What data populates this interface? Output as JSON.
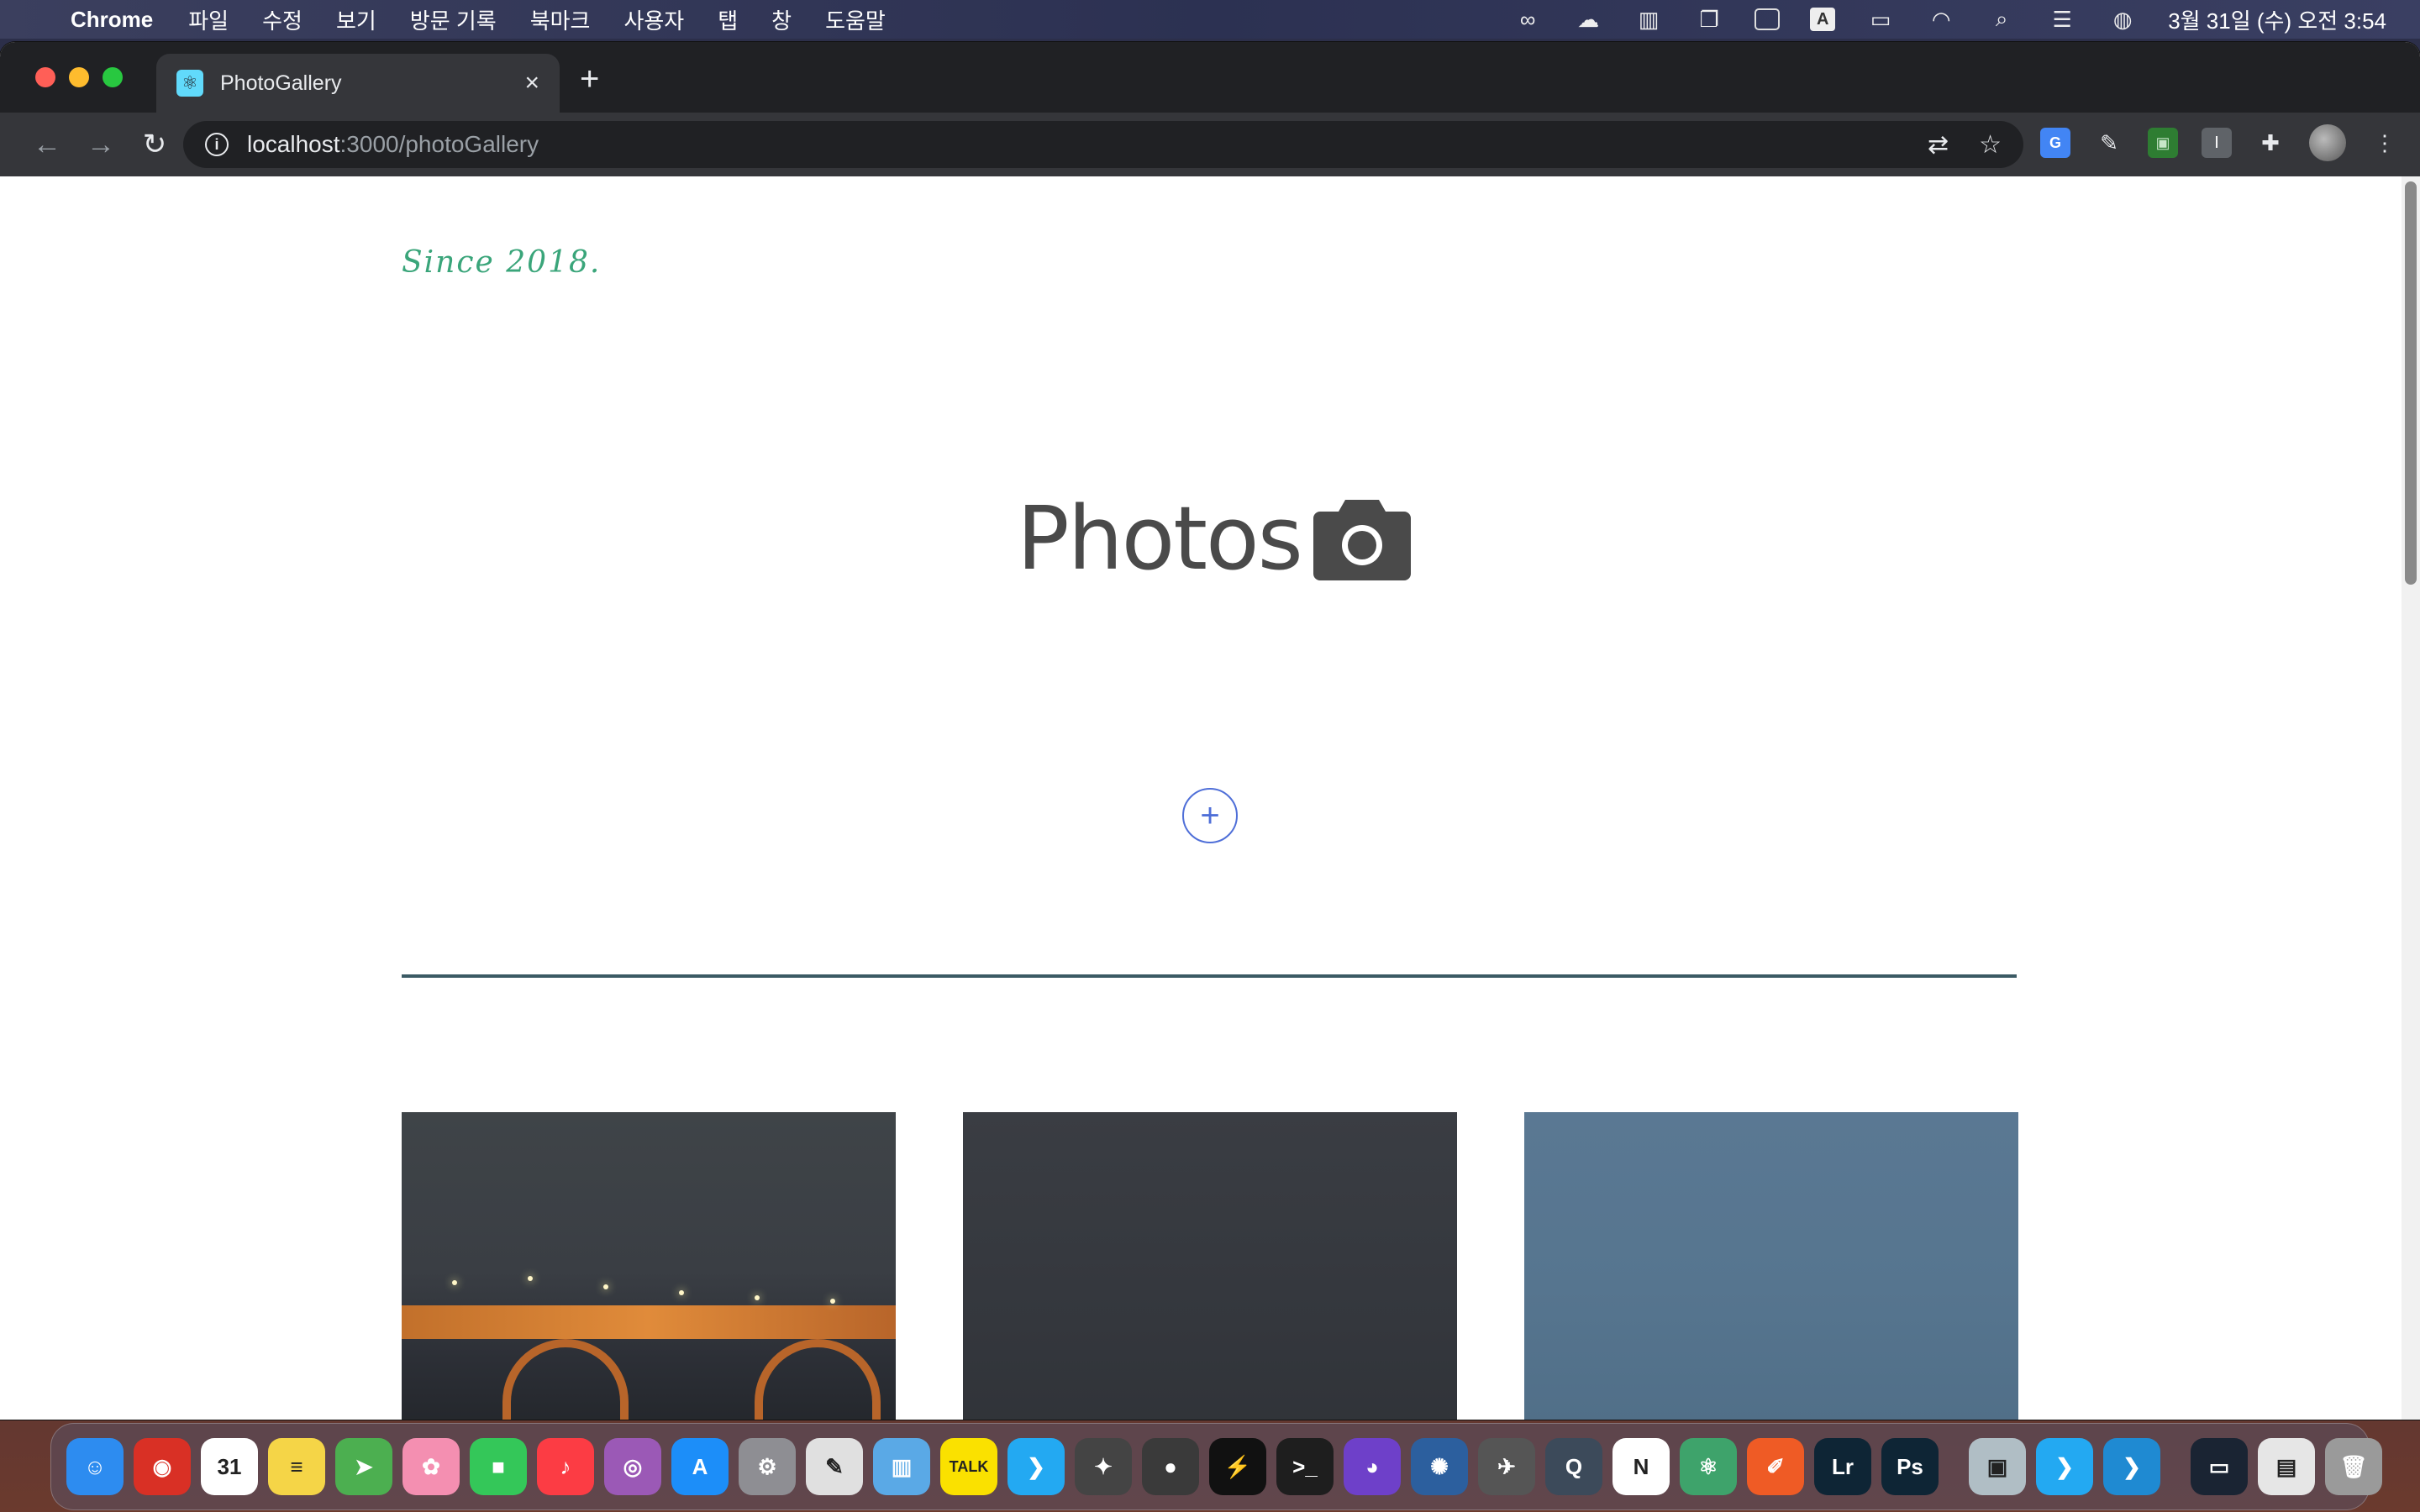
{
  "menubar": {
    "app_name": "Chrome",
    "menus": [
      "파일",
      "수정",
      "보기",
      "방문 기록",
      "북마크",
      "사용자",
      "탭",
      "창",
      "도움말"
    ],
    "status_icons": {
      "input_source": "A"
    },
    "clock": "3월 31일 (수) 오전 3:54"
  },
  "browser": {
    "tab_title": "PhotoGallery",
    "url_host": "localhost",
    "url_path": ":3000/photoGallery"
  },
  "page": {
    "since": "Since 2018.",
    "title": "Photos",
    "add_label": "+"
  },
  "dock": {
    "apps": [
      {
        "name": "finder-app-icon",
        "glyph": "☺",
        "color": "#2d8cf0"
      },
      {
        "name": "chrome-app-icon",
        "glyph": "◉",
        "color": "#d93025"
      },
      {
        "name": "calendar-app-icon",
        "glyph": "31",
        "color": "#ffffff"
      },
      {
        "name": "notes-app-icon",
        "glyph": "≡",
        "color": "#f5d547"
      },
      {
        "name": "maps-app-icon",
        "glyph": "➤",
        "color": "#4caf50"
      },
      {
        "name": "photos-app-icon",
        "glyph": "✿",
        "color": "#f48fb1"
      },
      {
        "name": "facetime-app-icon",
        "glyph": "■",
        "color": "#34c759"
      },
      {
        "name": "music-app-icon",
        "glyph": "♪",
        "color": "#fc3c44"
      },
      {
        "name": "podcast-app-icon",
        "glyph": "◎",
        "color": "#9b59b6"
      },
      {
        "name": "appstore-app-icon",
        "glyph": "A",
        "color": "#1c8ef9"
      },
      {
        "name": "settings-app-icon",
        "glyph": "⚙",
        "color": "#8e8e93"
      },
      {
        "name": "textedit-app-icon",
        "glyph": "✎",
        "color": "#e0e0e0"
      },
      {
        "name": "archive-app-icon",
        "glyph": "▥",
        "color": "#5aa9e6"
      },
      {
        "name": "kakaotalk-app-icon",
        "glyph": "TALK",
        "color": "#fae100"
      },
      {
        "name": "vscode-app-icon",
        "glyph": "❯",
        "color": "#23a9f2"
      },
      {
        "name": "finalcut-app-icon",
        "glyph": "✦",
        "color": "#444444"
      },
      {
        "name": "davinci-app-icon",
        "glyph": "●",
        "color": "#3a3a3a"
      },
      {
        "name": "iterm-app-icon",
        "glyph": "⚡",
        "color": "#111111"
      },
      {
        "name": "terminal-app-icon",
        "glyph": ">_",
        "color": "#1e1e1e"
      },
      {
        "name": "github-app-icon",
        "glyph": "◕",
        "color": "#6e40c9"
      },
      {
        "name": "disk-app-icon",
        "glyph": "✺",
        "color": "#2c5f9e"
      },
      {
        "name": "plane-app-icon",
        "glyph": "✈",
        "color": "#555555"
      },
      {
        "name": "quicktime-app-icon",
        "glyph": "Q",
        "color": "#3c4a5a"
      },
      {
        "name": "notion-app-icon",
        "glyph": "N",
        "color": "#ffffff"
      },
      {
        "name": "atom-app-icon",
        "glyph": "⚛",
        "color": "#3ea36b"
      },
      {
        "name": "postman-app-icon",
        "glyph": "✐",
        "color": "#ef5b25"
      },
      {
        "name": "lightroom-app-icon",
        "glyph": "Lr",
        "color": "#0e2535"
      },
      {
        "name": "photoshop-app-icon",
        "glyph": "Ps",
        "color": "#0e2535"
      },
      {
        "name": "preview-app-icon",
        "glyph": "▣",
        "color": "#b0bec5"
      },
      {
        "name": "vscode-alt-app-icon",
        "glyph": "❯",
        "color": "#23a9f2"
      },
      {
        "name": "vscode-insiders-app-icon",
        "glyph": "❯",
        "color": "#1f8ad2"
      }
    ],
    "stacks": [
      {
        "name": "recent-window-icon",
        "glyph": "▭",
        "color": "#1a2433"
      },
      {
        "name": "downloads-stack-icon",
        "glyph": "▤",
        "color": "#e6e6e6"
      },
      {
        "name": "trash-icon",
        "glyph": "🗑",
        "color": "#9a9a9a"
      }
    ]
  },
  "colors": {
    "since_text": "#3aa57a",
    "title_text": "#4a4a4a",
    "add_button": "#4f6fd8",
    "divider": "#3b5a64"
  }
}
